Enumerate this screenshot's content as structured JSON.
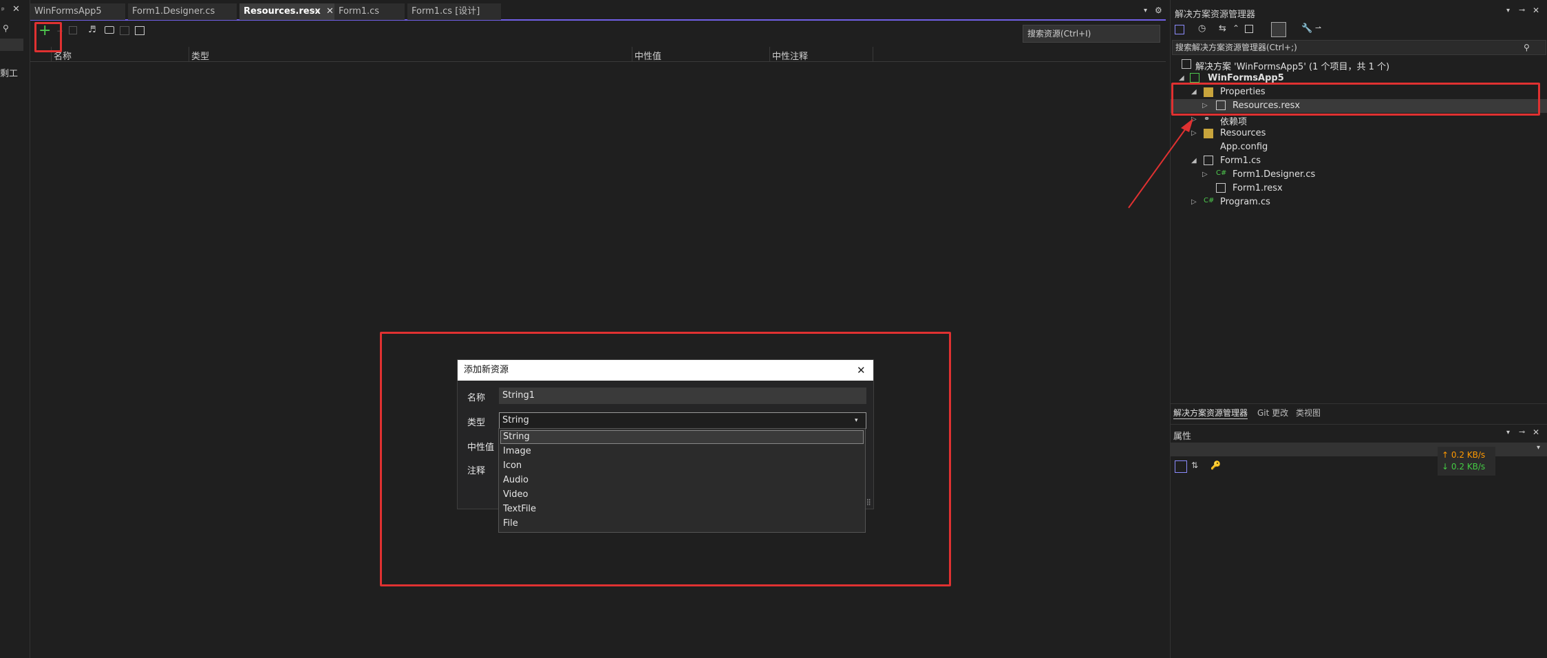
{
  "left_strip": {
    "pin": "ᵖ",
    "close": "✕",
    "label": "剩工"
  },
  "tabs": [
    {
      "label": "WinFormsApp5"
    },
    {
      "label": "Form1.Designer.cs"
    },
    {
      "label": "Resources.resx"
    },
    {
      "label": "Form1.cs"
    },
    {
      "label": "Form1.cs [设计]"
    }
  ],
  "editor": {
    "search_placeholder": "搜索资源(Ctrl+I)",
    "columns": [
      "名称",
      "类型",
      "中性值",
      "中性注释"
    ]
  },
  "dialog": {
    "title": "添加新资源",
    "name_label": "名称",
    "name_value": "String1",
    "type_label": "类型",
    "type_value": "String",
    "neutral_label": "中性值",
    "comment_label": "注释",
    "options": [
      "String",
      "Image",
      "Icon",
      "Audio",
      "Video",
      "TextFile",
      "File"
    ]
  },
  "solution_explorer": {
    "title": "解决方案资源管理器",
    "search_placeholder": "搜索解决方案资源管理器(Ctrl+;)",
    "tree": [
      {
        "label": "解决方案 'WinFormsApp5' (1 个项目，共 1 个)"
      },
      {
        "label": "WinFormsApp5"
      },
      {
        "label": "Properties"
      },
      {
        "label": "Resources.resx"
      },
      {
        "label": "依赖项"
      },
      {
        "label": "Resources"
      },
      {
        "label": "App.config"
      },
      {
        "label": "Form1.cs"
      },
      {
        "label": "Form1.Designer.cs"
      },
      {
        "label": "Form1.resx"
      },
      {
        "label": "Program.cs"
      }
    ],
    "bottom_tabs": [
      "解决方案资源管理器",
      "Git 更改",
      "类视图"
    ]
  },
  "properties": {
    "title": "属性",
    "net_up": "↑ 0.2 KB/s",
    "net_down": "↓ 0.2 KB/s"
  },
  "colors": {
    "accent": "#7160e8",
    "highlight": "#e03131",
    "net_up": "#ff9900",
    "net_down": "#44cc44"
  }
}
